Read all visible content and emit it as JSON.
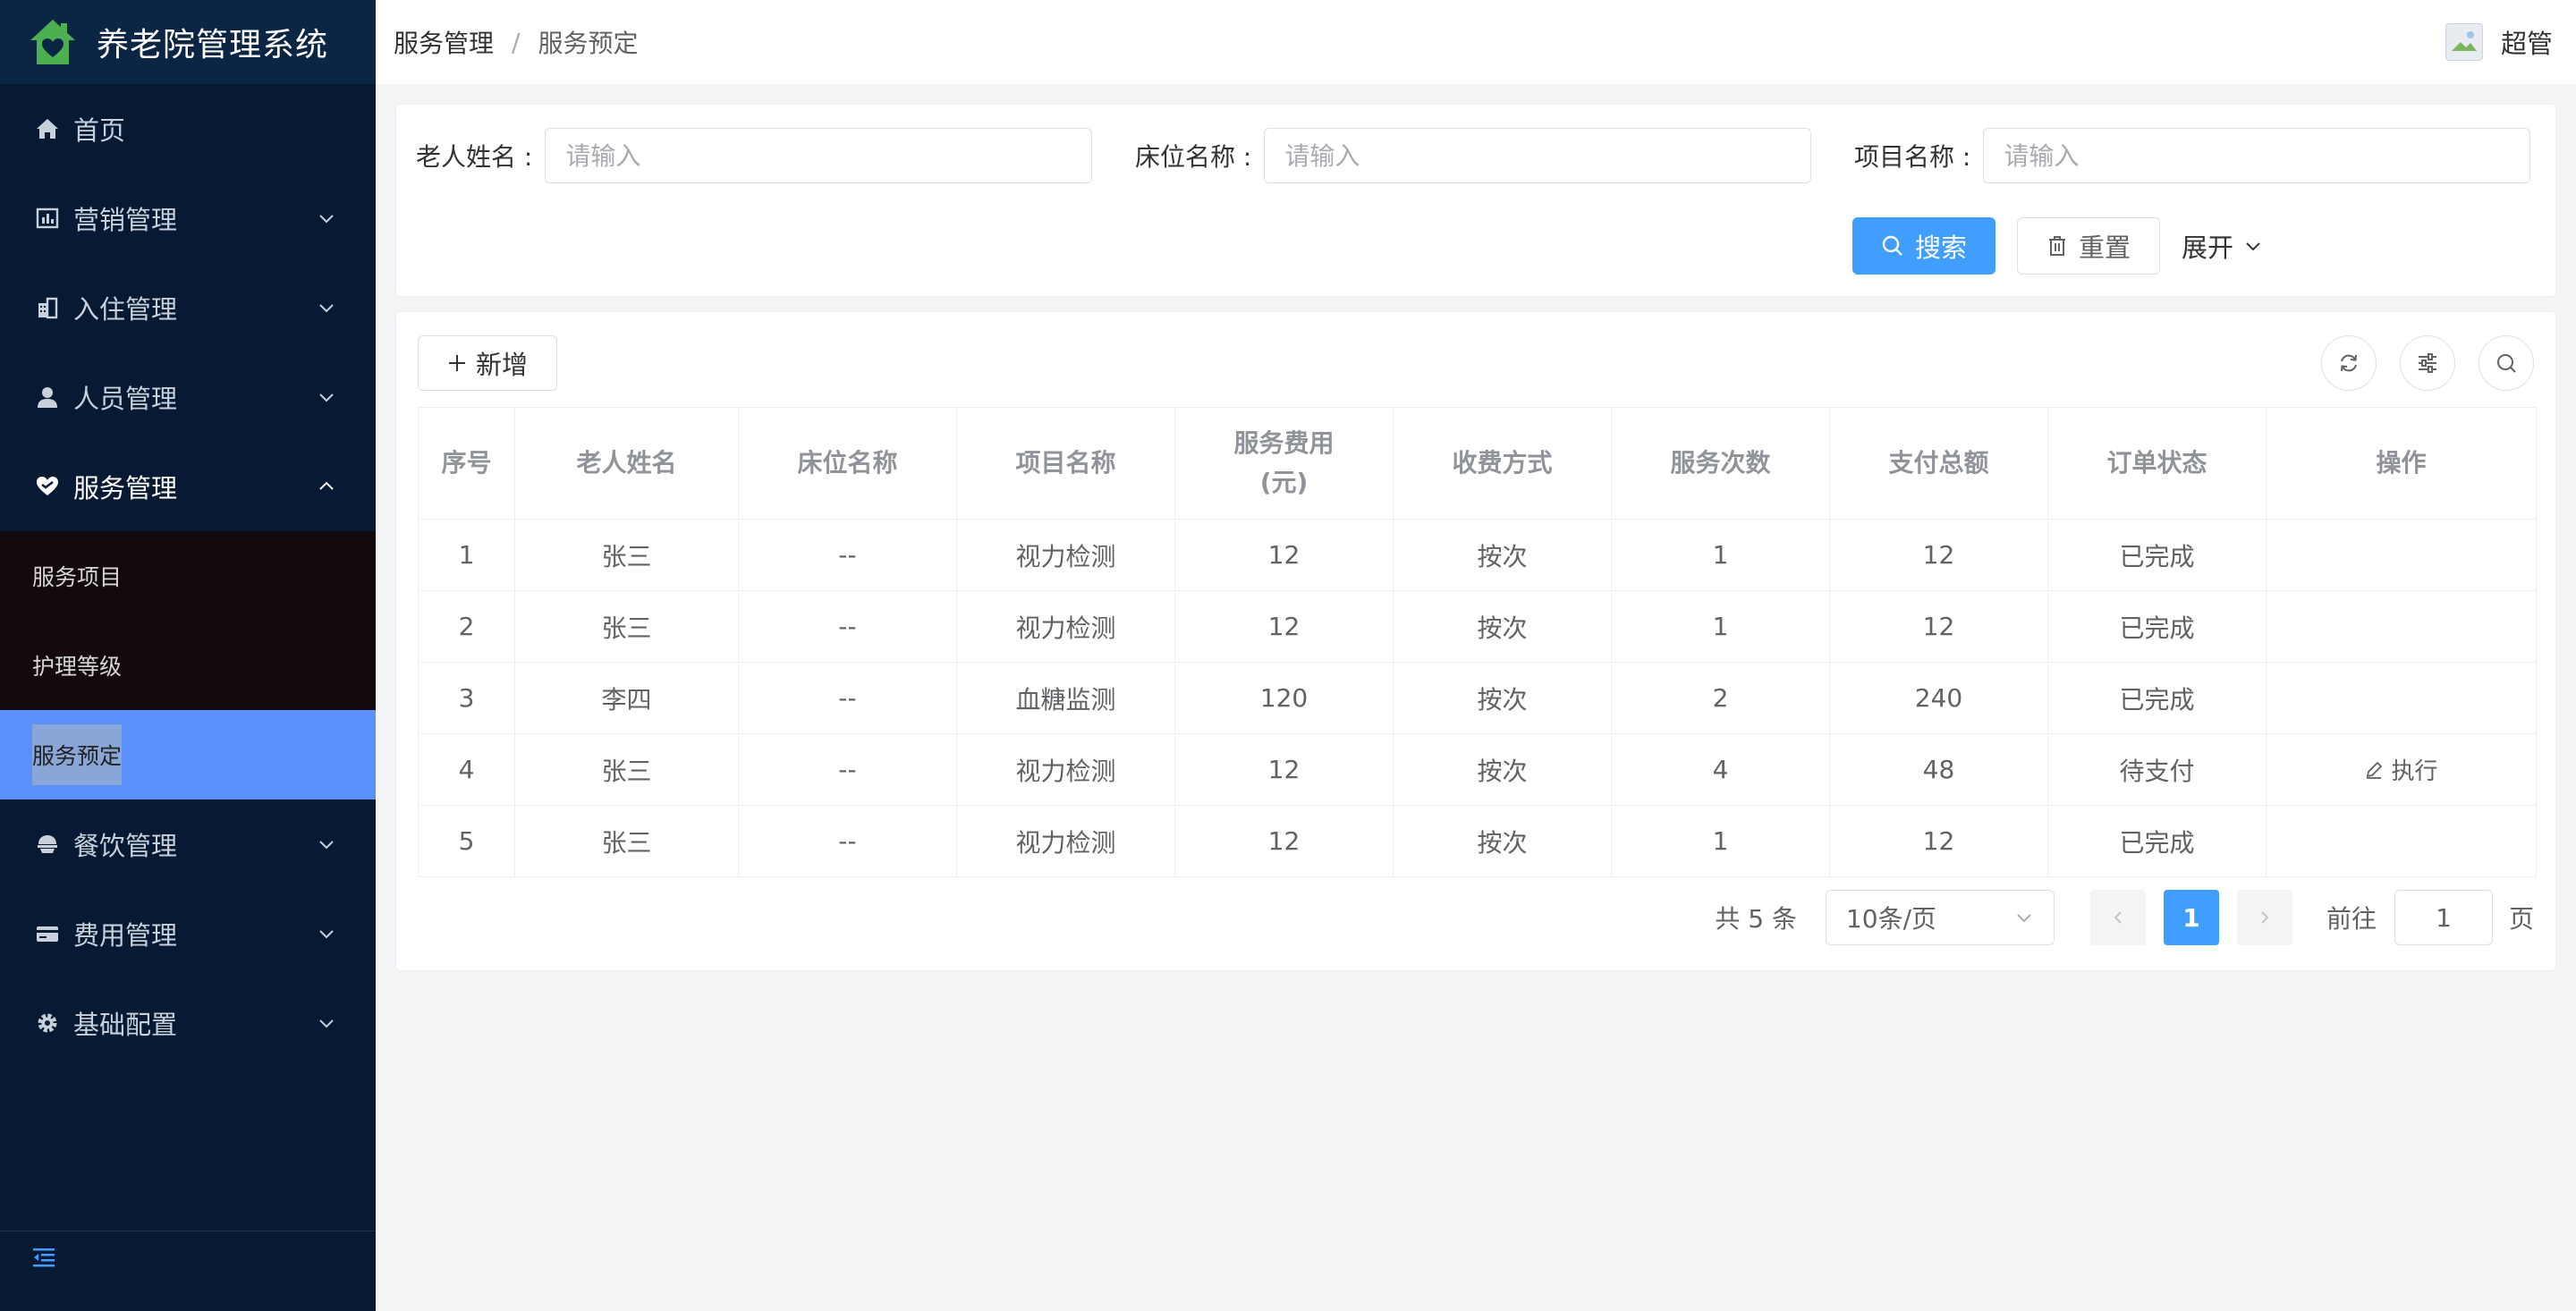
{
  "app": {
    "title": "养老院管理系统"
  },
  "sidebar": {
    "items": [
      {
        "label": "首页",
        "icon": "home-icon"
      },
      {
        "label": "营销管理",
        "icon": "chart-icon"
      },
      {
        "label": "入住管理",
        "icon": "building-icon"
      },
      {
        "label": "人员管理",
        "icon": "person-icon"
      },
      {
        "label": "服务管理",
        "icon": "heart-hand-icon"
      },
      {
        "label": "餐饮管理",
        "icon": "dining-icon"
      },
      {
        "label": "费用管理",
        "icon": "card-icon"
      },
      {
        "label": "基础配置",
        "icon": "gear-icon"
      }
    ],
    "submenu": [
      {
        "label": "服务项目"
      },
      {
        "label": "护理等级"
      },
      {
        "label": "服务预定"
      }
    ]
  },
  "header": {
    "breadcrumb": [
      "服务管理",
      "服务预定"
    ],
    "separator": "/",
    "user": "超管"
  },
  "search": {
    "fields": [
      {
        "label": "老人姓名 :",
        "placeholder": "请输入"
      },
      {
        "label": "床位名称 :",
        "placeholder": "请输入"
      },
      {
        "label": "项目名称 :",
        "placeholder": "请输入"
      }
    ],
    "search_label": "搜索",
    "reset_label": "重置",
    "expand_label": "展开"
  },
  "toolbar": {
    "add_label": "新增"
  },
  "table": {
    "columns": [
      "序号",
      "老人姓名",
      "床位名称",
      "项目名称",
      "服务费用",
      "(元)",
      "收费方式",
      "服务次数",
      "支付总额",
      "订单状态",
      "操作"
    ],
    "rows": [
      [
        "1",
        "张三",
        "--",
        "视力检测",
        "12",
        "按次",
        "1",
        "12",
        "已完成",
        ""
      ],
      [
        "2",
        "张三",
        "--",
        "视力检测",
        "12",
        "按次",
        "1",
        "12",
        "已完成",
        ""
      ],
      [
        "3",
        "李四",
        "--",
        "血糖监测",
        "120",
        "按次",
        "2",
        "240",
        "已完成",
        ""
      ],
      [
        "4",
        "张三",
        "--",
        "视力检测",
        "12",
        "按次",
        "4",
        "48",
        "待支付",
        "执行"
      ],
      [
        "5",
        "张三",
        "--",
        "视力检测",
        "12",
        "按次",
        "1",
        "12",
        "已完成",
        ""
      ]
    ]
  },
  "pagination": {
    "total": "共 5 条",
    "page_size": "10条/页",
    "current": "1",
    "goto_label": "前往",
    "goto_value": "1",
    "unit": "页"
  },
  "colors": {
    "accent": "#409eff",
    "sidebar_bg": "#081a33",
    "active_item": "#5b8ff9",
    "logo_green": "#4caf50"
  }
}
